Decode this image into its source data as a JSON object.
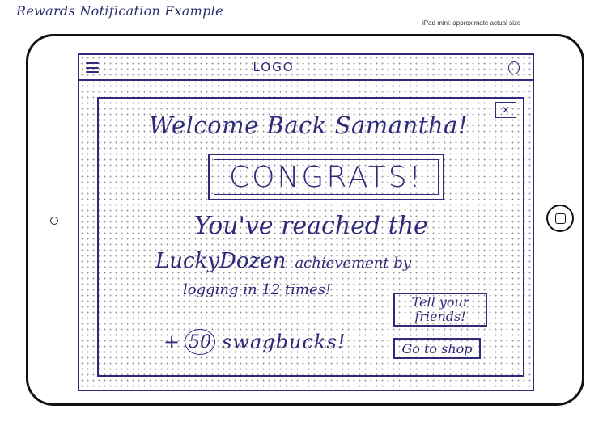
{
  "sheet": {
    "title": "Rewards Notification Example",
    "device_note": "iPad mini: approximate actual size"
  },
  "app": {
    "logo": "LOGO",
    "menu_icon": "hamburger-icon",
    "profile_icon": "profile-icon"
  },
  "modal": {
    "close_label": "×",
    "welcome": "Welcome Back Samantha!",
    "congrats": "CONGRATS!",
    "reached": "You've reached the",
    "achievement_name": "LuckyDozen",
    "achievement_rest": "achievement by",
    "times": "logging in 12 times!",
    "plus": "+",
    "points": "50",
    "currency": "swagbucks!",
    "share_button": "Tell your friends!",
    "shop_button": "Go to shop"
  },
  "colors": {
    "ink": "#2f2a7a",
    "device_frame": "#111111",
    "grid_dots": "#9a9a9a"
  }
}
